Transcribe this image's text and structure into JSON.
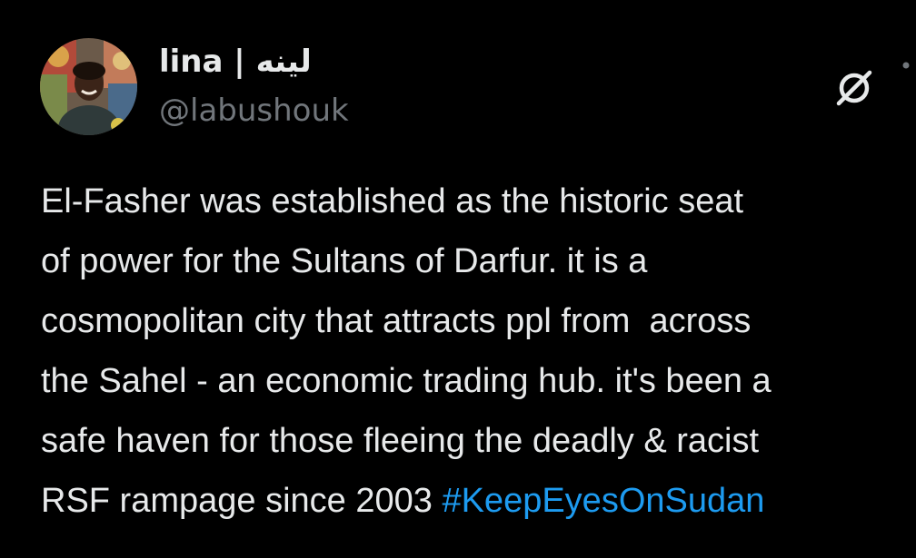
{
  "author": {
    "display_name": "lina | لينه",
    "handle": "@labushouk",
    "avatar": "profile-photo"
  },
  "header_actions": {
    "grok_icon": "grok-slash-circle-icon",
    "more_icon": "more-dots-icon"
  },
  "tweet": {
    "lines": [
      "El-Fasher was established as the historic seat",
      "of power for the Sultans of Darfur. it is a",
      "cosmopolitan city that attracts ppl from  across",
      "the Sahel - an economic trading hub. it's been a",
      "safe haven for those fleeing the deadly & racist"
    ],
    "last_line_text": "RSF rampage since 2003 ",
    "hashtag": "#KeepEyesOnSudan"
  },
  "colors": {
    "background": "#000000",
    "text": "#e7e9ea",
    "secondary_text": "#71767b",
    "link": "#1d9bf0"
  }
}
